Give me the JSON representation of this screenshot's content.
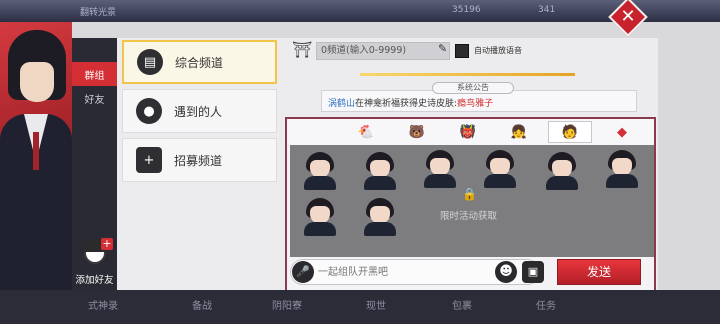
{
  "top_bar": {
    "title": "翻转光景",
    "currency_a": "35196",
    "currency_b": "341"
  },
  "close_label": "✕",
  "side_tabs": [
    {
      "label": "群组"
    },
    {
      "label": "好友"
    }
  ],
  "add_friend": {
    "label": "添加好友",
    "plus": "+"
  },
  "channels": [
    {
      "label": "综合频道",
      "icon": "megaphone-icon"
    },
    {
      "label": "遇到的人",
      "icon": "person-icon"
    },
    {
      "label": "招募频道",
      "icon": "plus-box-icon"
    }
  ],
  "channel_select": {
    "value": "0频道(输入0-9999)"
  },
  "auto_voice_label": "自动播放语音",
  "announcement": {
    "title": "系统公告",
    "player": "涡鹤山",
    "middle": "在神龛祈福获得史诗皮肤:",
    "reward": "瘾鸟雅子"
  },
  "emoji_tabs": [
    {
      "icon": "chicken-icon",
      "glyph": "🐔"
    },
    {
      "icon": "bear-icon",
      "glyph": "🐻"
    },
    {
      "icon": "warrior-icon",
      "glyph": "👹"
    },
    {
      "icon": "girl-icon",
      "glyph": "👧"
    },
    {
      "icon": "shikigami-icon",
      "glyph": "🧑"
    },
    {
      "icon": "diamond-icon",
      "glyph": "◆"
    }
  ],
  "locked_text": "限时活动获取",
  "chat": {
    "placeholder": "一起组队开黑吧",
    "send_label": "发送"
  },
  "bottom_nav": [
    {
      "label": "式神录"
    },
    {
      "label": "备战"
    },
    {
      "label": "阴阳寮"
    },
    {
      "label": "现世"
    },
    {
      "label": "包裹"
    },
    {
      "label": "任务"
    }
  ],
  "colors": {
    "accent_red": "#d42f35",
    "gold": "#f0c64a",
    "player_name": "#2f6fc2",
    "reward_name": "#d02b2b"
  }
}
